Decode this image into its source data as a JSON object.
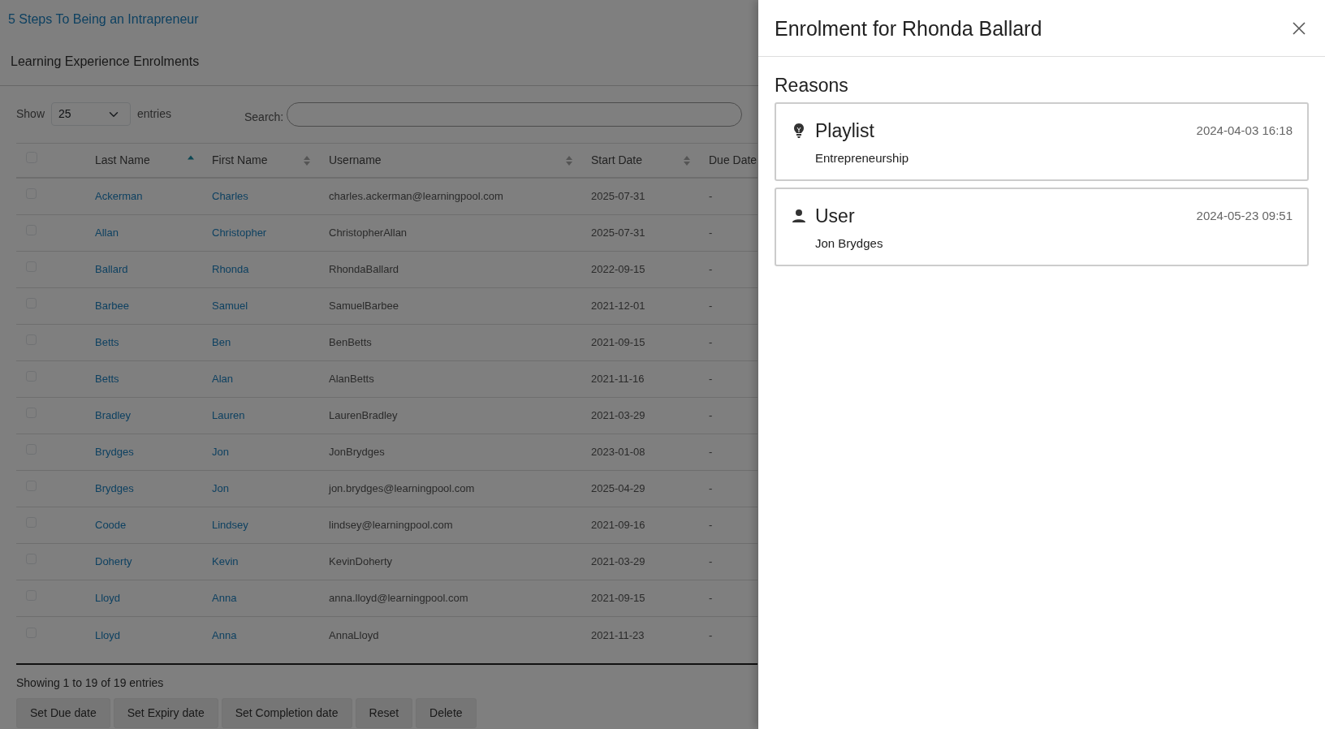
{
  "page": {
    "title_link": "5 Steps To Being an Intrapreneur",
    "section_title": "Learning Experience Enrolments"
  },
  "table_controls": {
    "show_label": "Show",
    "page_size": "25",
    "entries_label": "entries",
    "search_label": "Search:"
  },
  "table": {
    "select_all_checked": false,
    "columns": [
      {
        "label": "Last Name",
        "sorted": true
      },
      {
        "label": "First Name",
        "sorted": false
      },
      {
        "label": "Username",
        "sorted": false
      },
      {
        "label": "Start Date",
        "sorted": false
      },
      {
        "label": "Due Date"
      }
    ],
    "rows": [
      {
        "checked": false,
        "last_name": "Ackerman",
        "first_name": "Charles",
        "username": "charles.ackerman@learningpool.com",
        "start_date": "2025-07-31",
        "due_date": "-"
      },
      {
        "checked": false,
        "last_name": "Allan",
        "first_name": "Christopher",
        "username": "ChristopherAllan",
        "start_date": "2025-07-31",
        "due_date": "-"
      },
      {
        "checked": false,
        "last_name": "Ballard",
        "first_name": "Rhonda",
        "username": "RhondaBallard",
        "start_date": "2022-09-15",
        "due_date": "-"
      },
      {
        "checked": false,
        "last_name": "Barbee",
        "first_name": "Samuel",
        "username": "SamuelBarbee",
        "start_date": "2021-12-01",
        "due_date": "-"
      },
      {
        "checked": false,
        "last_name": "Betts",
        "first_name": "Ben",
        "username": "BenBetts",
        "start_date": "2021-09-15",
        "due_date": "-"
      },
      {
        "checked": false,
        "last_name": "Betts",
        "first_name": "Alan",
        "username": "AlanBetts",
        "start_date": "2021-11-16",
        "due_date": "-"
      },
      {
        "checked": false,
        "last_name": "Bradley",
        "first_name": "Lauren",
        "username": "LaurenBradley",
        "start_date": "2021-03-29",
        "due_date": "-"
      },
      {
        "checked": false,
        "last_name": "Brydges",
        "first_name": "Jon",
        "username": "JonBrydges",
        "start_date": "2023-01-08",
        "due_date": "-"
      },
      {
        "checked": false,
        "last_name": "Brydges",
        "first_name": "Jon",
        "username": "jon.brydges@learningpool.com",
        "start_date": "2025-04-29",
        "due_date": "-"
      },
      {
        "checked": false,
        "last_name": "Coode",
        "first_name": "Lindsey",
        "username": "lindsey@learningpool.com",
        "start_date": "2021-09-16",
        "due_date": "-"
      },
      {
        "checked": false,
        "last_name": "Doherty",
        "first_name": "Kevin",
        "username": "KevinDoherty",
        "start_date": "2021-03-29",
        "due_date": "-"
      },
      {
        "checked": false,
        "last_name": "Lloyd",
        "first_name": "Anna",
        "username": "anna.lloyd@learningpool.com",
        "start_date": "2021-09-15",
        "due_date": "-"
      },
      {
        "checked": false,
        "last_name": "Lloyd",
        "first_name": "Anna",
        "username": "AnnaLloyd",
        "start_date": "2021-11-23",
        "due_date": "-"
      }
    ]
  },
  "footer": {
    "info": "Showing 1 to 19 of 19 entries",
    "buttons": [
      {
        "label": "Set Due date",
        "disabled": true
      },
      {
        "label": "Set Expiry date",
        "disabled": true
      },
      {
        "label": "Set Completion date",
        "disabled": true
      },
      {
        "label": "Reset",
        "disabled": true
      },
      {
        "label": "Delete",
        "disabled": true
      }
    ]
  },
  "panel": {
    "title": "Enrolment for Rhonda Ballard",
    "section": "Reasons",
    "reasons": [
      {
        "kind": "playlist",
        "title": "Playlist",
        "date": "2024-04-03 16:18",
        "detail": "Entrepreneurship"
      },
      {
        "kind": "user",
        "title": "User",
        "date": "2024-05-23 09:51",
        "detail": "Jon Brydges"
      }
    ]
  }
}
